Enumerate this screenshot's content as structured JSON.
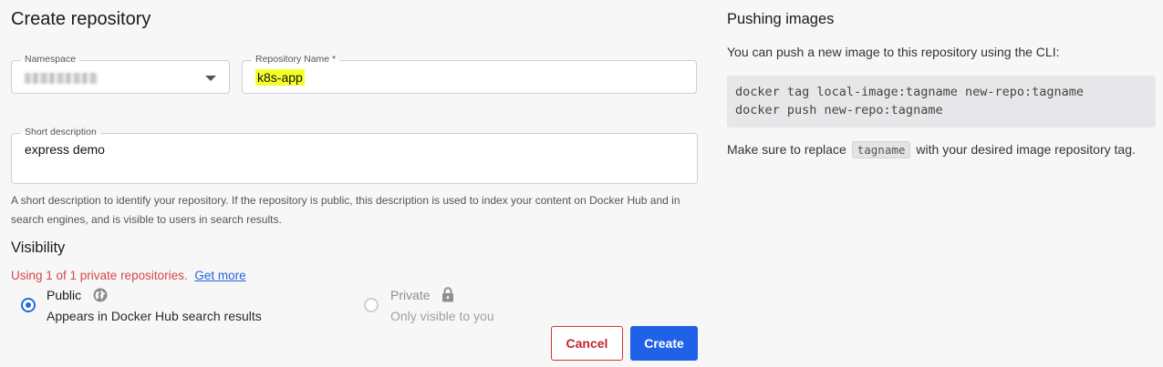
{
  "page": {
    "title": "Create repository"
  },
  "form": {
    "namespace": {
      "label": "Namespace",
      "value_redacted": true
    },
    "repo_name": {
      "label": "Repository Name *",
      "value": "k8s-app"
    },
    "description": {
      "label": "Short description",
      "value": "express demo",
      "help": "A short description to identify your repository. If the repository is public, this description is used to index your content on Docker Hub and in search engines, and is visible to users in search results."
    }
  },
  "visibility": {
    "title": "Visibility",
    "quota_text": "Using 1 of 1 private repositories.",
    "get_more": "Get more",
    "public": {
      "label": "Public",
      "desc": "Appears in Docker Hub search results",
      "selected": true,
      "icon": "globe-icon"
    },
    "private": {
      "label": "Private",
      "desc": "Only visible to you",
      "selected": false,
      "disabled": true,
      "icon": "lock-icon"
    }
  },
  "actions": {
    "cancel": "Cancel",
    "create": "Create"
  },
  "push": {
    "title": "Pushing images",
    "intro": "You can push a new image to this repository using the CLI:",
    "code_line1": "docker tag local-image:tagname new-repo:tagname",
    "code_line2": "docker push new-repo:tagname",
    "note_before": "Make sure to replace",
    "note_code": "tagname",
    "note_after": "with your desired image repository tag."
  },
  "colors": {
    "accent": "#1f62e8",
    "danger": "#d0353b",
    "quota": "#d5474c",
    "link": "#2166d9",
    "highlight": "#f5ff2a"
  }
}
